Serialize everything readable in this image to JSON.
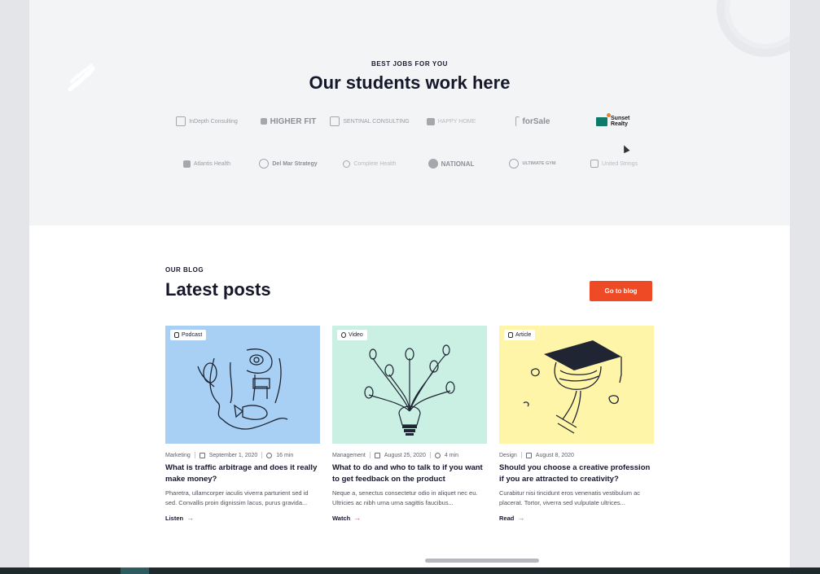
{
  "jobs_section": {
    "eyebrow": "BEST JOBS FOR YOU",
    "title": "Our students work here",
    "logos": [
      {
        "name": "InDepth Consulting",
        "icon": "box-icon"
      },
      {
        "name": "HIGHER FIT",
        "icon": "lines-icon"
      },
      {
        "name": "SENTINAL CONSULTING",
        "icon": "waves-icon"
      },
      {
        "name": "HAPPY HOME",
        "icon": "house-icon"
      },
      {
        "name": "forSale",
        "icon": "sign-icon"
      },
      {
        "name": "Sunset Realty",
        "icon": "house-sun-icon"
      },
      {
        "name": "Atlantis Health",
        "icon": "cross-icon"
      },
      {
        "name": "Del Mar Strategy",
        "icon": "swirl-icon"
      },
      {
        "name": "Complete Health",
        "icon": "heart-icon"
      },
      {
        "name": "NATIONAL",
        "icon": "shield-icon"
      },
      {
        "name": "ULTIMATE GYM",
        "icon": "circle-icon"
      },
      {
        "name": "United Strings",
        "icon": "squares-icon"
      }
    ]
  },
  "blog": {
    "eyebrow": "OUR BLOG",
    "title": "Latest posts",
    "cta": "Go to blog",
    "posts": [
      {
        "badge": "Podcast",
        "badge_icon": "microphone-icon",
        "image_bg": "#a8d0f5",
        "category": "Marketing",
        "date": "September 1, 2020",
        "duration": "16 min",
        "title": "What is traffic arbitrage and does it really make money?",
        "excerpt": "Pharetra, ullamcorper iaculis viverra parturient sed id sed. Convallis proin dignissim lacus, purus gravida...",
        "action": "Listen"
      },
      {
        "badge": "Video",
        "badge_icon": "play-icon",
        "image_bg": "#c9f0e3",
        "category": "Management",
        "date": "August 25, 2020",
        "duration": "4 min",
        "title": "What to do and who to talk to if you want to get feedback on the product",
        "excerpt": "Neque a, senectus consectetur odio in aliquet nec eu. Ultricies ac nibh urna urna sagittis faucibus...",
        "action": "Watch"
      },
      {
        "badge": "Article",
        "badge_icon": "document-icon",
        "image_bg": "#fff5a8",
        "category": "Design",
        "date": "August 8, 2020",
        "duration": "",
        "title": "Should you choose a creative profession if you are attracted to creativity?",
        "excerpt": "Curabitur nisi tincidunt eros venenatis vestibulum ac placerat. Tortor, viverra sed vulputate ultrices...",
        "action": "Read"
      }
    ]
  },
  "colors": {
    "accent": "#ef4a26",
    "section_bg": "#f3f4f6",
    "heading": "#16172b"
  }
}
